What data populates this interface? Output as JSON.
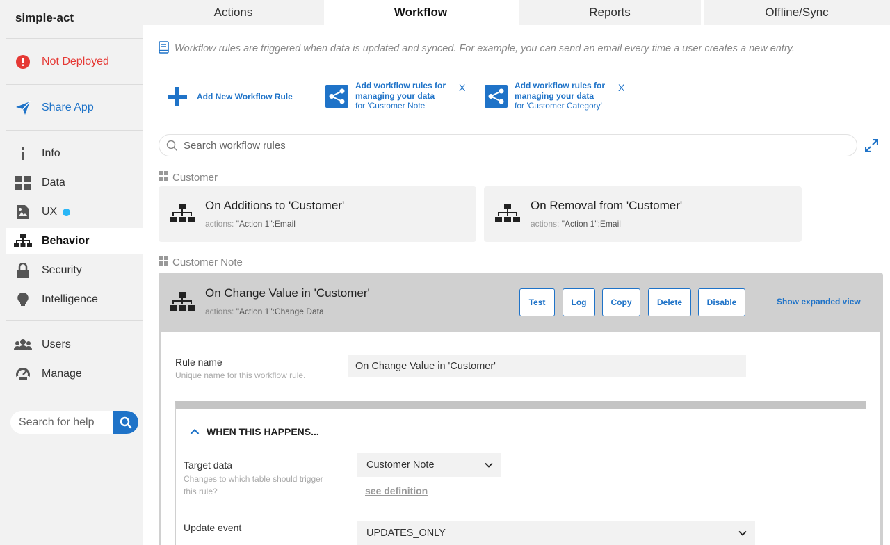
{
  "app": {
    "title": "simple-act"
  },
  "sidebar": {
    "deploy_status": "Not Deployed",
    "share": "Share App",
    "items": [
      {
        "label": "Info",
        "icon": "info-icon"
      },
      {
        "label": "Data",
        "icon": "data-grid-icon"
      },
      {
        "label": "UX",
        "icon": "ux-icon"
      },
      {
        "label": "Behavior",
        "icon": "hierarchy-icon"
      },
      {
        "label": "Security",
        "icon": "lock-icon"
      },
      {
        "label": "Intelligence",
        "icon": "lightbulb-icon"
      }
    ],
    "users": "Users",
    "manage": "Manage",
    "help_placeholder": "Search for help"
  },
  "tabs": [
    "Actions",
    "Workflow",
    "Reports",
    "Offline/Sync"
  ],
  "info_text": "Workflow rules are triggered when data is updated and synced. For example, you can send an email every time a user creates a new entry.",
  "quick_actions": {
    "add_new": "Add New Workflow Rule",
    "suggestions": [
      {
        "line1": "Add workflow rules for",
        "line2": "managing your data",
        "line3": "for 'Customer Note'",
        "close": "X"
      },
      {
        "line1": "Add workflow rules for",
        "line2": "managing your data",
        "line3": "for 'Customer Category'",
        "close": "X"
      }
    ]
  },
  "search": {
    "placeholder": "Search workflow rules"
  },
  "groups": [
    {
      "name": "Customer",
      "rules": [
        {
          "title": "On Additions to 'Customer'",
          "actions_label": "actions:",
          "actions_value": "\"Action 1\":Email"
        },
        {
          "title": "On Removal from 'Customer'",
          "actions_label": "actions:",
          "actions_value": "\"Action 1\":Email"
        }
      ]
    },
    {
      "name": "Customer Note",
      "rules": [
        {
          "title": "On Change Value in 'Customer'",
          "actions_label": "actions:",
          "actions_value": "\"Action 1\":Change Data"
        }
      ]
    }
  ],
  "expanded": {
    "buttons": [
      "Test",
      "Log",
      "Copy",
      "Delete",
      "Disable"
    ],
    "expand_link": "Show expanded view",
    "rule_name_label": "Rule name",
    "rule_name_hint": "Unique name for this workflow rule.",
    "rule_name_value": "On Change Value in 'Customer'",
    "when_header": "WHEN THIS HAPPENS...",
    "target_label": "Target data",
    "target_hint": "Changes to which table should trigger this rule?",
    "target_value": "Customer Note",
    "see_definition": "see definition",
    "update_label": "Update event",
    "update_value": "UPDATES_ONLY"
  },
  "colors": {
    "accent": "#1f73c8",
    "error": "#e53935",
    "sidebar_bg": "#f2f2f2"
  }
}
